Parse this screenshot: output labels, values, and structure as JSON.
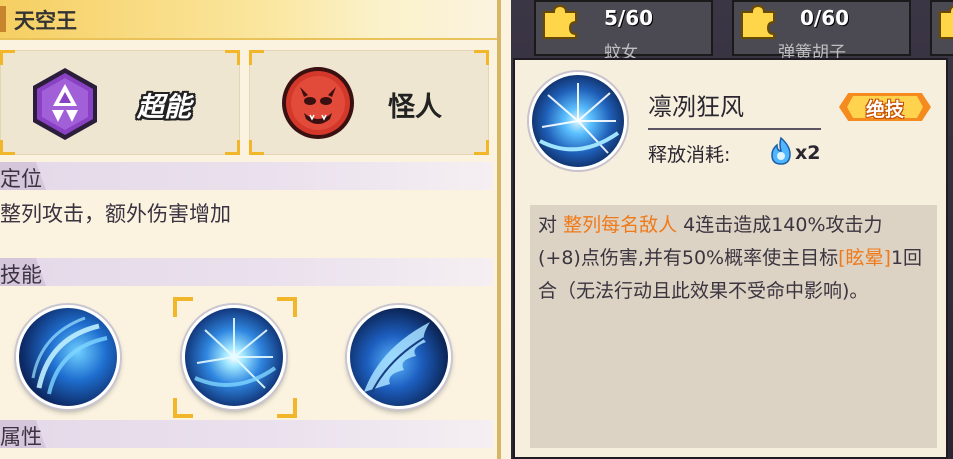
{
  "hero": {
    "name": "天空王"
  },
  "types": [
    {
      "label": "超能",
      "icon": "psychic-hexagon-icon"
    },
    {
      "label": "怪人",
      "icon": "monster-demon-icon"
    }
  ],
  "role": {
    "section_title": "定位",
    "description": "整列攻击，额外伤害增加"
  },
  "skills": {
    "section_title": "技能",
    "selected_index": 1
  },
  "attributes": {
    "section_title": "属性"
  },
  "cards": [
    {
      "count": "5/60",
      "name": "蚊女"
    },
    {
      "count": "0/60",
      "name": "弹簧胡子"
    }
  ],
  "tooltip": {
    "skill_name": "凛冽狂风",
    "badge": "绝技",
    "cost_label": "释放消耗:",
    "cost_count": "x2",
    "desc_prefix": "对",
    "desc_target": "整列每名敌人",
    "desc_mid": "4连击造成140%攻击力(+8)点伤害,并有50%概率使主目标",
    "desc_status": "[眩晕]",
    "desc_suffix": "1回合（无法行动且此效果不受命中影响)。"
  },
  "colors": {
    "highlight": "#ef7a1a",
    "accent_gold": "#f2b62b",
    "panel_bg": "#fbf3e0"
  }
}
